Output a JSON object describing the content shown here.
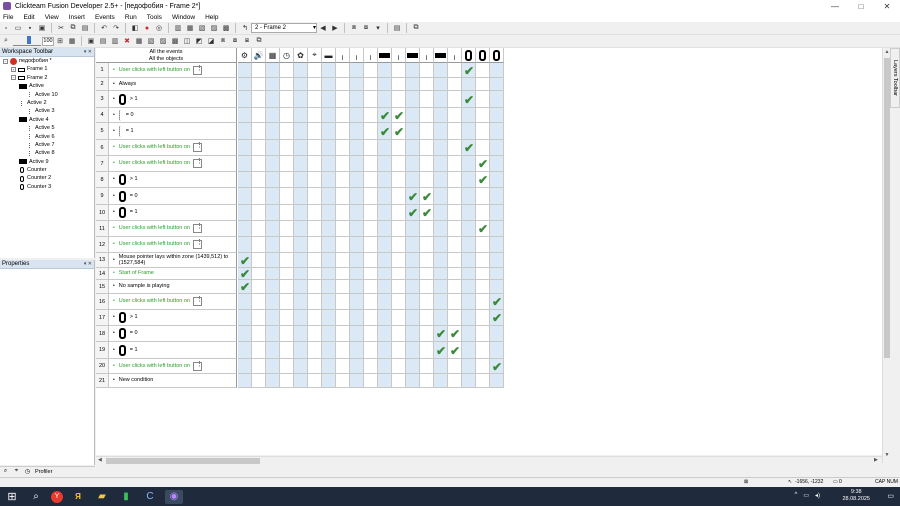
{
  "window": {
    "title": "Clickteam Fusion Developer 2.5+ - [педофобия - Frame 2*]",
    "controls": [
      "—",
      "□",
      "✕"
    ]
  },
  "menu": [
    "File",
    "Edit",
    "View",
    "Insert",
    "Events",
    "Run",
    "Tools",
    "Window",
    "Help"
  ],
  "toolbar": {
    "frame_select": "2 - Frame 2",
    "zoom": "100"
  },
  "workspace": {
    "title": "Workspace Toolbar",
    "tree": [
      {
        "label": "педофобия *",
        "level": 0,
        "icon": "app"
      },
      {
        "label": "Frame 1",
        "level": 1,
        "icon": "frame"
      },
      {
        "label": "Frame 2",
        "level": 1,
        "icon": "frame"
      },
      {
        "label": "Active",
        "level": 2,
        "icon": "black"
      },
      {
        "label": "Active 10",
        "level": 3,
        "icon": "thin"
      },
      {
        "label": "Active 2",
        "level": 2,
        "icon": "thin"
      },
      {
        "label": "Active 3",
        "level": 3,
        "icon": "thin"
      },
      {
        "label": "Active 4",
        "level": 2,
        "icon": "black"
      },
      {
        "label": "Active 5",
        "level": 3,
        "icon": "thin"
      },
      {
        "label": "Active 6",
        "level": 3,
        "icon": "thin"
      },
      {
        "label": "Active 7",
        "level": 3,
        "icon": "thin"
      },
      {
        "label": "Active 8",
        "level": 3,
        "icon": "thin"
      },
      {
        "label": "Active 9",
        "level": 2,
        "icon": "black"
      },
      {
        "label": "Counter",
        "level": 2,
        "icon": "counter"
      },
      {
        "label": "Counter 2",
        "level": 2,
        "icon": "counter"
      },
      {
        "label": "Counter 3",
        "level": 2,
        "icon": "counter"
      }
    ]
  },
  "properties": {
    "title": "Properties"
  },
  "profiler": {
    "label": "Profiler"
  },
  "layers_tab": "Layers Toolbar",
  "event_header": {
    "line1": "All the events",
    "line2": "All the objects"
  },
  "events": [
    {
      "num": "1",
      "type": "click",
      "text": "User clicks with left button on"
    },
    {
      "num": "2",
      "type": "plain",
      "text": "Always"
    },
    {
      "num": "3",
      "type": "counter",
      "text": "> 1"
    },
    {
      "num": "4",
      "type": "counter-thin",
      "text": "= 0"
    },
    {
      "num": "5",
      "type": "counter-thin",
      "text": "= 1"
    },
    {
      "num": "6",
      "type": "click",
      "text": "User clicks with left button on"
    },
    {
      "num": "7",
      "type": "click",
      "text": "User clicks with left button on"
    },
    {
      "num": "8",
      "type": "counter",
      "text": "> 1"
    },
    {
      "num": "9",
      "type": "counter",
      "text": "= 0"
    },
    {
      "num": "10",
      "type": "counter",
      "text": "= 1"
    },
    {
      "num": "11",
      "type": "click",
      "text": "User clicks with left button on"
    },
    {
      "num": "12",
      "type": "click",
      "text": "User clicks with left button on"
    },
    {
      "num": "13",
      "type": "plain",
      "text": "Mouse pointer lays within zone (1439,512) to (1527,584)"
    },
    {
      "num": "14",
      "type": "green",
      "text": "Start of Frame"
    },
    {
      "num": "15",
      "type": "plain",
      "text": "No sample is playing"
    },
    {
      "num": "16",
      "type": "click",
      "text": "User clicks with left button on"
    },
    {
      "num": "17",
      "type": "counter",
      "text": "> 1"
    },
    {
      "num": "18",
      "type": "counter",
      "text": "= 0"
    },
    {
      "num": "19",
      "type": "counter",
      "text": "= 1"
    },
    {
      "num": "20",
      "type": "click",
      "text": "User clicks with left button on"
    },
    {
      "num": "21",
      "type": "plain",
      "text": "New condition"
    }
  ],
  "object_columns": [
    {
      "icon": "special-icon",
      "glyph": "⚙"
    },
    {
      "icon": "sound-icon",
      "glyph": "🔊"
    },
    {
      "icon": "storyboard-icon",
      "glyph": "▦"
    },
    {
      "icon": "timer-icon",
      "glyph": "◷"
    },
    {
      "icon": "create-icon",
      "glyph": "✿"
    },
    {
      "icon": "mouse-icon",
      "glyph": "⌖"
    },
    {
      "icon": "active-icon",
      "glyph": "▬"
    },
    {
      "icon": "active-thin-icon",
      "glyph": "╷"
    },
    {
      "icon": "active-thin-icon",
      "glyph": "╷"
    },
    {
      "icon": "active-thin-icon",
      "glyph": "╷"
    },
    {
      "icon": "active-black-icon",
      "glyph": "black"
    },
    {
      "icon": "active-thin-icon",
      "glyph": "╷"
    },
    {
      "icon": "active-black-icon",
      "glyph": "black"
    },
    {
      "icon": "active-thin-icon",
      "glyph": "╷"
    },
    {
      "icon": "active-black-icon",
      "glyph": "black"
    },
    {
      "icon": "active-thin-icon",
      "glyph": "╷"
    },
    {
      "icon": "counter-icon",
      "glyph": "counter"
    },
    {
      "icon": "counter-icon",
      "glyph": "counter"
    },
    {
      "icon": "counter-icon",
      "glyph": "counter"
    }
  ],
  "checks": [
    {
      "row": 1,
      "col": 17
    },
    {
      "row": 3,
      "col": 17
    },
    {
      "row": 4,
      "col": 11
    },
    {
      "row": 4,
      "col": 12
    },
    {
      "row": 5,
      "col": 11
    },
    {
      "row": 5,
      "col": 12
    },
    {
      "row": 6,
      "col": 17
    },
    {
      "row": 7,
      "col": 18
    },
    {
      "row": 8,
      "col": 18
    },
    {
      "row": 9,
      "col": 13
    },
    {
      "row": 9,
      "col": 14
    },
    {
      "row": 10,
      "col": 13
    },
    {
      "row": 10,
      "col": 14
    },
    {
      "row": 11,
      "col": 18
    },
    {
      "row": 13,
      "col": 1
    },
    {
      "row": 14,
      "col": 1
    },
    {
      "row": 15,
      "col": 1
    },
    {
      "row": 16,
      "col": 19
    },
    {
      "row": 17,
      "col": 19
    },
    {
      "row": 18,
      "col": 15
    },
    {
      "row": 18,
      "col": 16
    },
    {
      "row": 19,
      "col": 15
    },
    {
      "row": 19,
      "col": 16
    },
    {
      "row": 20,
      "col": 19
    }
  ],
  "status": {
    "coords": "-1656, -1232",
    "count": "0",
    "keys": "CAP NUM"
  },
  "taskbar": {
    "time": "9:38",
    "date": "28.08.2025"
  }
}
